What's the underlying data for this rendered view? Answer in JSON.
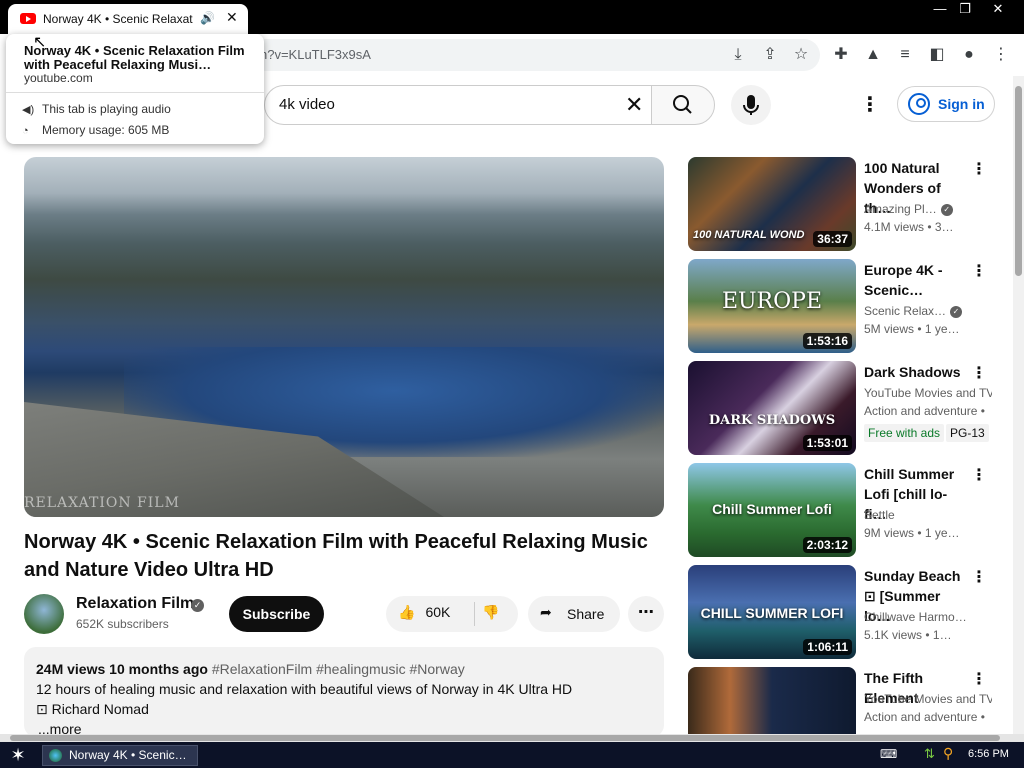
{
  "browser": {
    "tab_title": "Norway 4K • Scenic Relaxation",
    "url_partial": "n?v=KLuTLF3x9sA",
    "window_controls": [
      "—",
      "❐",
      "✕"
    ]
  },
  "hovercard": {
    "title": "Norway 4K • Scenic Relaxation Film with Peaceful Relaxing Musi…",
    "domain": "youtube.com",
    "audio_text": "This tab is playing audio",
    "memory_text": "Memory usage: 605 MB"
  },
  "youtube": {
    "search_query": "4k video",
    "sign_in": "Sign in"
  },
  "video": {
    "watermark": "RELAXATION FILM",
    "title": "Norway 4K • Scenic Relaxation Film with Peaceful Relaxing Music and Nature Video Ultra HD",
    "channel": "Relaxation Film",
    "subscribers": "652K subscribers",
    "subscribe_label": "Subscribe",
    "likes": "60K",
    "share_label": "Share",
    "description": {
      "views_time": "24M views  10 months ago",
      "tags": "#RelaxationFilm #healingmusic #Norway",
      "line1": "12 hours of healing music and relaxation with beautiful views of Norway in 4K Ultra HD",
      "line2": "⊡ Richard Nomad",
      "more": "...more"
    }
  },
  "recommendations": [
    {
      "title": "100 Natural Wonders of th…",
      "channel": "Amazing Pl…",
      "verified": true,
      "views": "4.1M views  • 3…",
      "duration": "36:37",
      "thumb_text": "100 NATURAL WOND"
    },
    {
      "title": "Europe 4K - Scenic…",
      "channel": "Scenic Relax…",
      "verified": true,
      "views": "5M views  • 1 ye…",
      "duration": "1:53:16",
      "thumb_text": "EUROPE"
    },
    {
      "title": "Dark Shadows",
      "channel": "YouTube Movies and TV",
      "views": "Action and adventure •",
      "badges": [
        "Free with ads",
        "PG-13"
      ],
      "duration": "1:53:01",
      "thumb_text": "DARK SHADOWS"
    },
    {
      "title": "Chill Summer Lofi [chill lo-fi…",
      "channel": "Settle",
      "views": "9M views  • 1 ye…",
      "duration": "2:03:12",
      "thumb_text": "Chill Summer Lofi"
    },
    {
      "title": "Sunday Beach ⊡ [Summer lo…",
      "channel": "Chillwave Harmo…",
      "views": "5.1K views  • 1…",
      "duration": "1:06:11",
      "thumb_text": "CHILL SUMMER LOFI"
    },
    {
      "title": "The Fifth Element",
      "channel": "YouTube Movies and TV",
      "views": "Action and adventure •",
      "duration": "",
      "thumb_text": ""
    }
  ],
  "taskbar": {
    "task_label": "Norway 4K • Scenic…",
    "clock": "6:56 PM"
  },
  "colors": {
    "youtube_red": "#ff0000",
    "link_blue": "#065fd4",
    "taskbar": "#0c1227"
  }
}
